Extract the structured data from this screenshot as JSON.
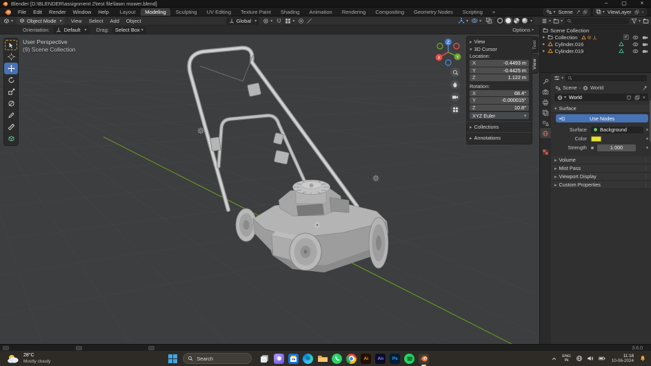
{
  "colors": {
    "accent_blue": "#4772b3",
    "blender_orange": "#f5792a",
    "mesh_object_orange": "#e8923c",
    "mesh_data_green": "#3fbf8f",
    "world_color_swatch": "#e6e237",
    "axis_x": "#e84a42",
    "axis_y": "#6ca22c",
    "axis_z": "#4a7fd6"
  },
  "titlebar": {
    "app_title": "Blender [D:\\BLENDER\\assignment 2\\test file\\lawn mower.blend]"
  },
  "topbar": {
    "menus": [
      "File",
      "Edit",
      "Render",
      "Window",
      "Help"
    ],
    "workspaces": [
      "Layout",
      "Modeling",
      "Sculpting",
      "UV Editing",
      "Texture Paint",
      "Shading",
      "Animation",
      "Rendering",
      "Compositing",
      "Geometry Nodes",
      "Scripting"
    ],
    "active_workspace": "Modeling",
    "add_workspace": "+",
    "scene_name": "Scene",
    "viewlayer_name": "ViewLayer"
  },
  "viewport_header": {
    "mode": "Object Mode",
    "menus": [
      "View",
      "Select",
      "Add",
      "Object"
    ],
    "orientation": "Global",
    "options": "Options"
  },
  "tool_settings": {
    "orientation_label": "Orientation:",
    "orientation_value": "Default",
    "drag_label": "Drag:",
    "drag_value": "Select Box"
  },
  "viewport": {
    "overlay_title": "User Perspective",
    "overlay_subtitle": "(9) Scene Collection",
    "gizmo_axes": {
      "x": "X",
      "y": "Y",
      "z": "Z"
    }
  },
  "sidebar_tabs": {
    "tool": "Tool",
    "view": "View"
  },
  "npanel": {
    "view_section": "View",
    "cursor_section": "3D Cursor",
    "location_label": "Location:",
    "rotation_label": "Rotation:",
    "location": {
      "x_label": "X",
      "x": "-0.4493 m",
      "y_label": "Y",
      "y": "-0.4425 m",
      "z_label": "Z",
      "z": "1.122 m"
    },
    "rotation": {
      "x_label": "X",
      "x": "68.4°",
      "y_label": "Y",
      "y": "-0.000015°",
      "z_label": "Z",
      "z": "10.8°"
    },
    "euler_mode": "XYZ Euler",
    "collections_section": "Collections",
    "annotations_section": "Annotations"
  },
  "outliner": {
    "root_label": "Scene Collection",
    "rows": [
      {
        "label": "Collection"
      },
      {
        "label": "Cylinder.016"
      },
      {
        "label": "Cylinder.019"
      }
    ]
  },
  "properties": {
    "breadcrumb_scene": "Scene",
    "breadcrumb_sep": "›",
    "breadcrumb_world": "World",
    "datablock_name": "World",
    "surface_section": "Surface",
    "use_nodes_label": "Use Nodes",
    "surface_label": "Surface",
    "surface_value": "Background",
    "color_label": "Color",
    "strength_label": "Strength",
    "strength_value": "1.000",
    "volume_section": "Volume",
    "mist_section": "Mist Pass",
    "viewport_display_section": "Viewport Display",
    "custom_props_section": "Custom Properties"
  },
  "statusbar": {
    "version": "3.6.0"
  },
  "taskbar": {
    "weather_temp": "28°C",
    "weather_desc": "Mostly cloudy",
    "search_label": "Search",
    "apps": [
      {
        "name": "task-view"
      },
      {
        "name": "copilot"
      },
      {
        "name": "microsoft-store"
      },
      {
        "name": "edge"
      },
      {
        "name": "file-explorer"
      },
      {
        "name": "whatsapp"
      },
      {
        "name": "chrome"
      },
      {
        "name": "illustrator",
        "label": "Ai"
      },
      {
        "name": "animate",
        "label": "An"
      },
      {
        "name": "photoshop",
        "label": "Ps"
      },
      {
        "name": "spotify"
      },
      {
        "name": "blender"
      }
    ],
    "tray": {
      "lang_top": "ENG",
      "lang_bottom": "IN",
      "time": "11:18",
      "date": "10-06-2024"
    }
  }
}
